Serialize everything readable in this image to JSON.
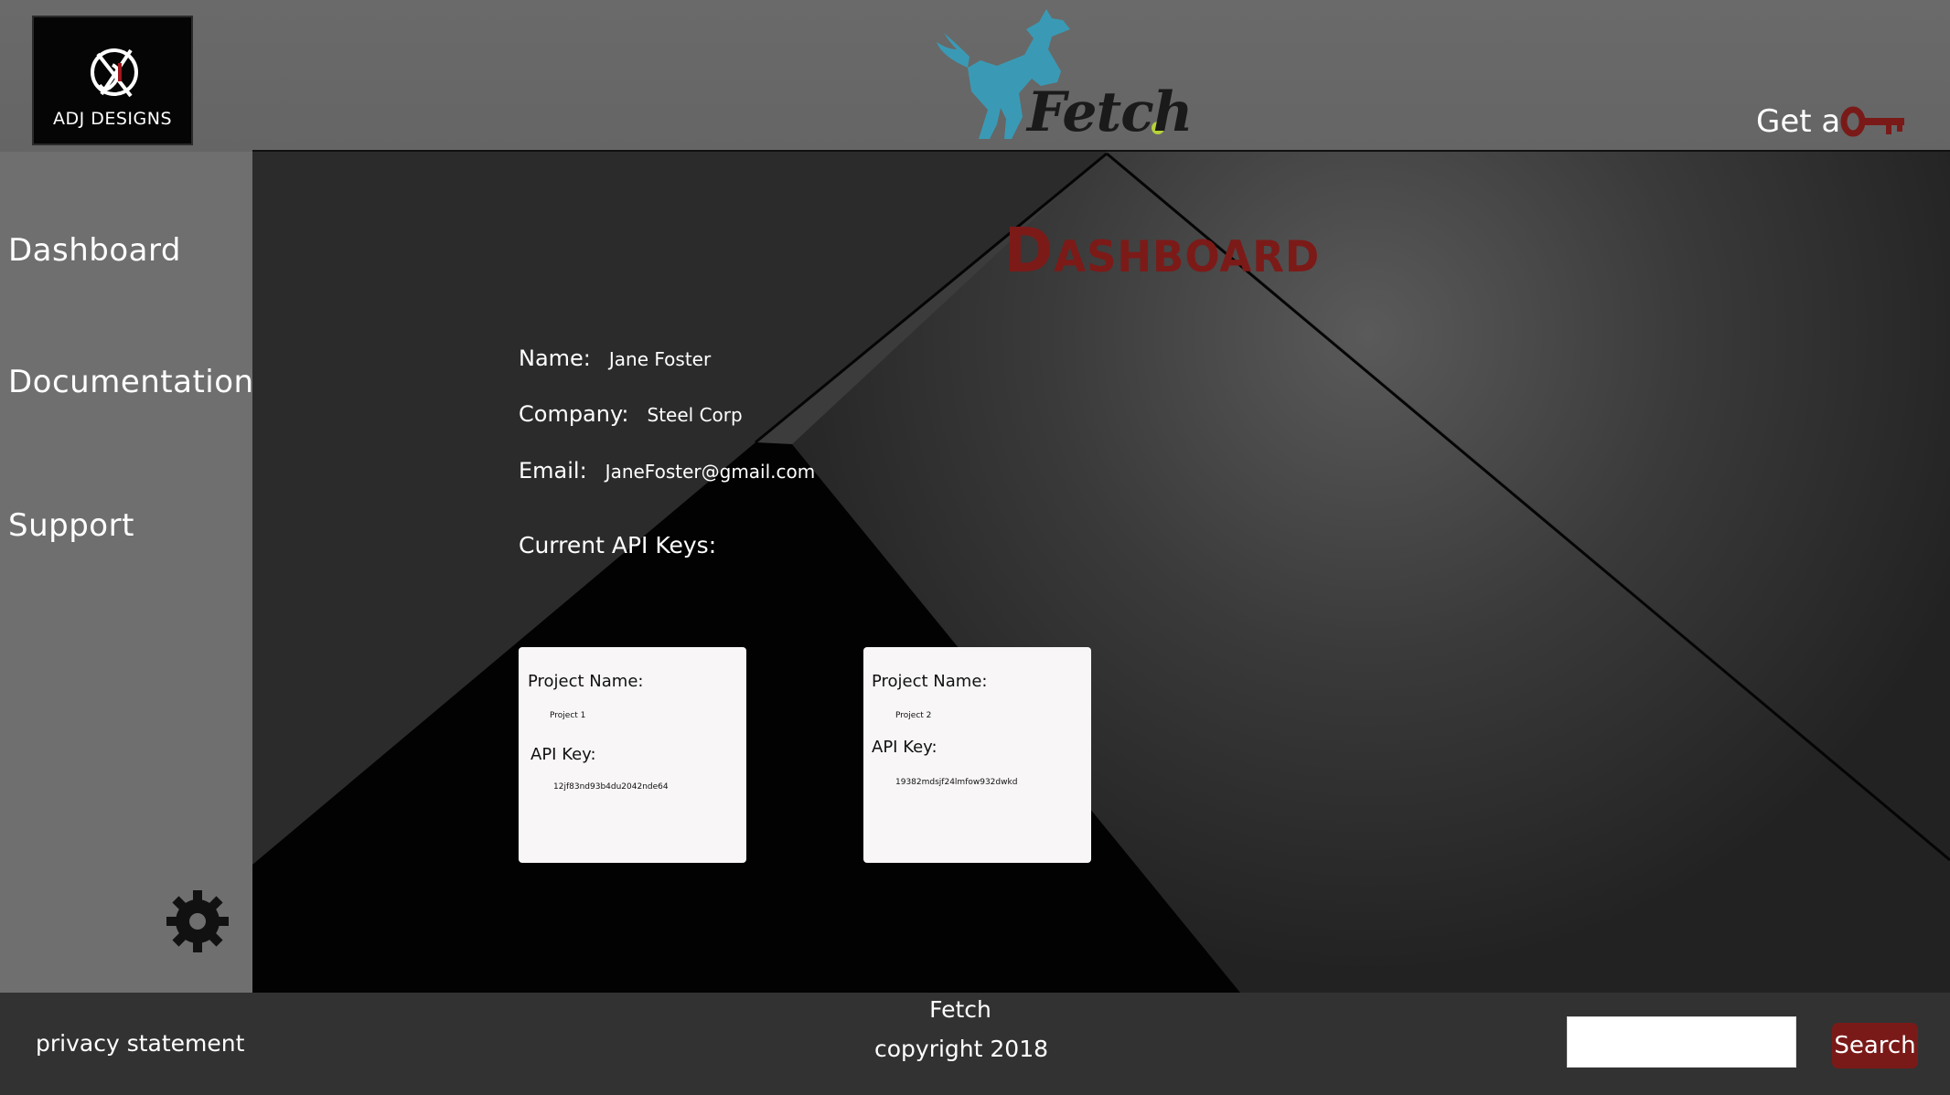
{
  "header": {
    "logo_text": "ADJ DESIGNS",
    "brand_name": "Fetch",
    "get_key_label": "Get a",
    "key_icon": "key-icon",
    "brand_icon": "dog-icon"
  },
  "sidebar": {
    "items": [
      {
        "label": "Dashboard"
      },
      {
        "label": "Documentation"
      },
      {
        "label": "Support"
      }
    ],
    "settings_icon": "gear-icon"
  },
  "main": {
    "title": "Dashboard",
    "profile": {
      "name_label": "Name:",
      "name_value": "Jane Foster",
      "company_label": "Company:",
      "company_value": "Steel Corp",
      "email_label": "Email:",
      "email_value": "JaneFoster@gmail.com"
    },
    "api_keys_label": "Current API Keys:",
    "cards": [
      {
        "project_label": "Project Name:",
        "project_value": "Project 1",
        "key_label": "API Key:",
        "key_value": "12jf83nd93b4du2042nde64"
      },
      {
        "project_label": "Project Name:",
        "project_value": "Project 2",
        "key_label": "API Key:",
        "key_value": "19382mdsjf24lmfow932dwkd"
      }
    ]
  },
  "footer": {
    "privacy": "privacy statement",
    "brand": "Fetch",
    "copyright": "copyright 2018",
    "search_value": "",
    "search_button": "Search"
  },
  "colors": {
    "accent": "#7a1a18",
    "brand_dog": "#3a9ab5",
    "ball": "#b6d23a"
  }
}
